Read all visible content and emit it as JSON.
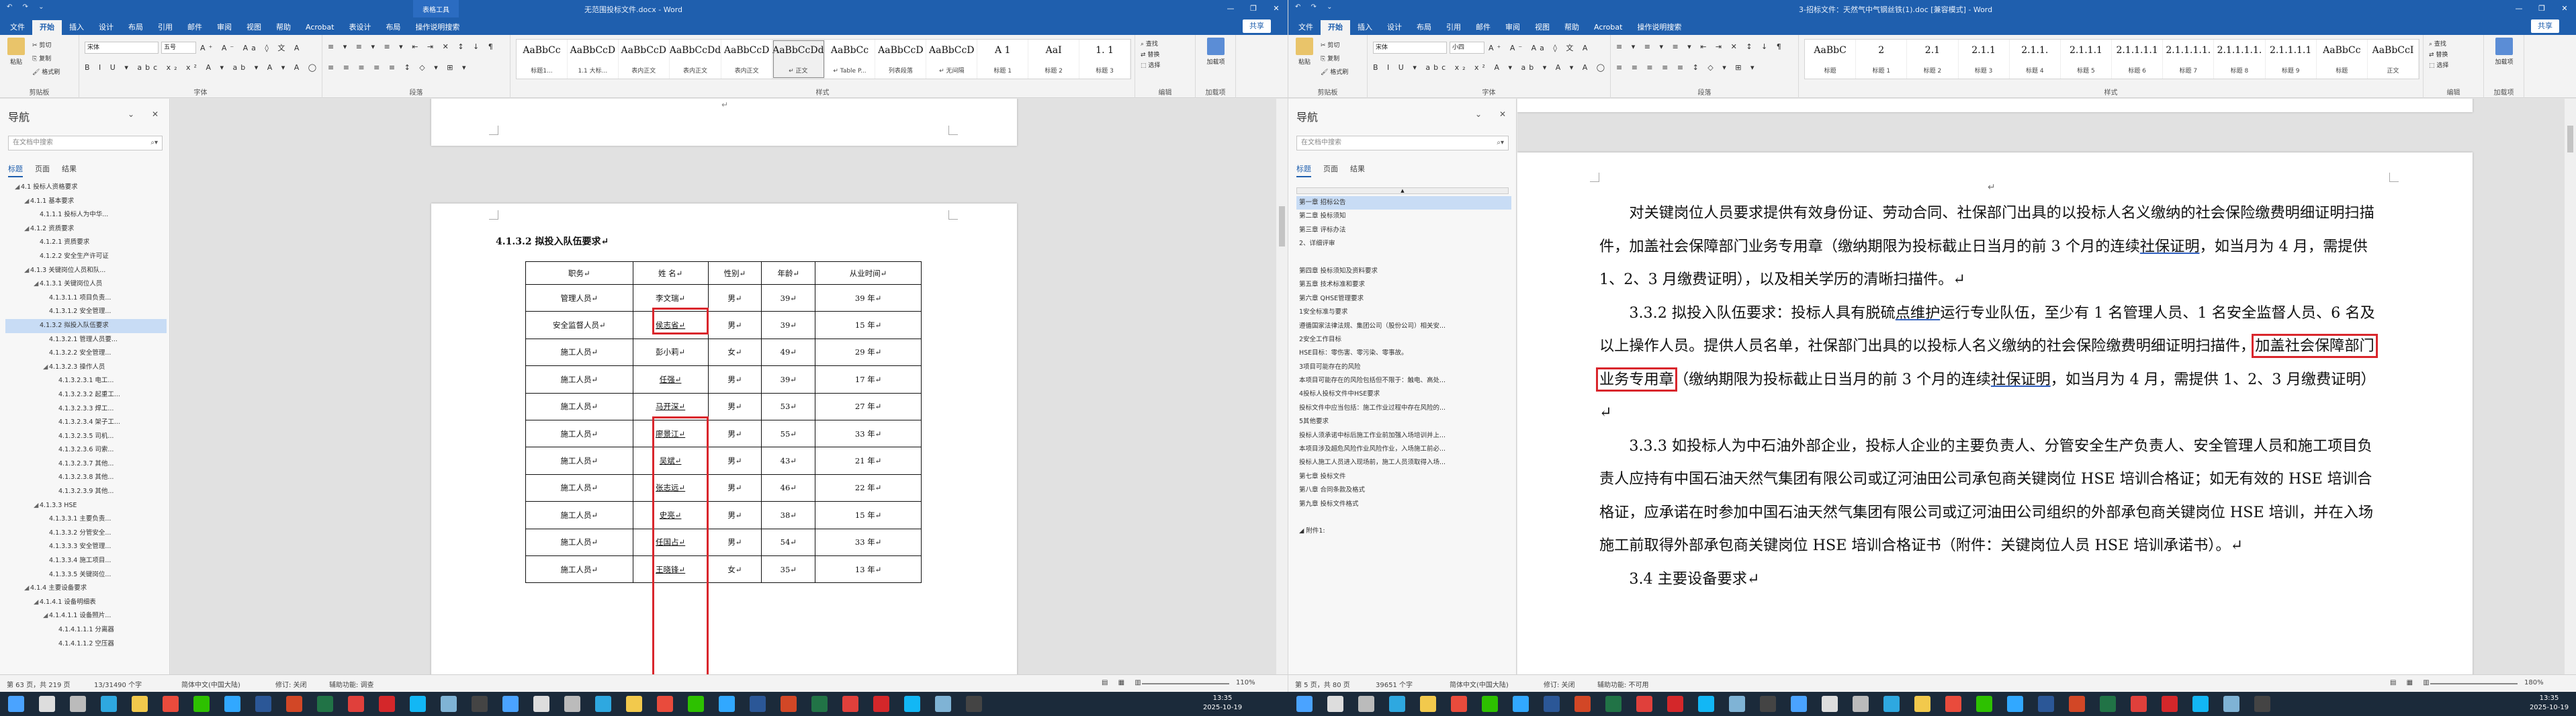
{
  "left": {
    "title": {
      "context_tab": "表格工具",
      "doc": "无范围投标文件.docx - Word",
      "quick_access": "↶ ↷ ⌄"
    },
    "tabs": [
      "文件",
      "开始",
      "插入",
      "设计",
      "布局",
      "引用",
      "邮件",
      "审阅",
      "视图",
      "帮助",
      "Acrobat",
      "表设计",
      "布局",
      "操作说明搜索"
    ],
    "share": "共享",
    "clipboard": {
      "paste": "粘贴",
      "cut": "剪切",
      "copy": "复制",
      "fmt": "格式刷",
      "label": "剪贴板"
    },
    "font": {
      "name": "宋体",
      "size": "五号",
      "label": "字体",
      "row1": "A⁺ A⁻ Aa ◊ 文 A",
      "row2": "B I U ▾ abc x₂ x²  A ▾ ab ▾ A ▾ A ◯"
    },
    "paragraph": {
      "label": "段落",
      "row1": "≡ ▾ ≡ ▾ ≡ ▾ ⇤ ⇥ ✕ ↕ ↓ ¶",
      "row2": "≡ ≡ ≡ ≡ ≡ ↕ ◇ ▾ ⊞ ▾"
    },
    "styles": {
      "label": "样式",
      "items": [
        {
          "preview": "AaBbCc",
          "name": "标题1..."
        },
        {
          "preview": "AaBbCcD",
          "name": "1.1 大标..."
        },
        {
          "preview": "AaBbCcD",
          "name": "表内正文"
        },
        {
          "preview": "AaBbCcDd",
          "name": "表内正文"
        },
        {
          "preview": "AaBbCcD",
          "name": "表内正文"
        },
        {
          "preview": "AaBbCcDd",
          "name": "↵ 正文"
        },
        {
          "preview": "AaBbCc",
          "name": "↵ Table P..."
        },
        {
          "preview": "AaBbCcD",
          "name": "列表段落"
        },
        {
          "preview": "AaBbCcD",
          "name": "↵ 无间隔"
        },
        {
          "preview": "A 1",
          "name": "标题 1"
        },
        {
          "preview": "AaI",
          "name": "标题 2"
        },
        {
          "preview": "1. 1",
          "name": "标题 3"
        }
      ]
    },
    "editing": {
      "find": "查找",
      "replace": "替换",
      "select": "选择",
      "label": "编辑"
    },
    "addin": {
      "name": "加载项",
      "label": "加载项"
    },
    "nav": {
      "title": "导航",
      "search_placeholder": "在文档中搜索",
      "tabs": [
        "标题",
        "页面",
        "结果"
      ],
      "items": [
        {
          "t": "◢",
          "label": "4.1 投标人资格要求",
          "lvl": 1,
          "hl": false
        },
        {
          "t": "◢",
          "label": "4.1.1 基本要求",
          "lvl": 2,
          "hl": false
        },
        {
          "t": "",
          "label": "4.1.1.1 投标人为中华...",
          "lvl": 3,
          "hl": false
        },
        {
          "t": "◢",
          "label": "4.1.2 资质要求",
          "lvl": 2,
          "hl": false
        },
        {
          "t": "",
          "label": "4.1.2.1 资质要求",
          "lvl": 3,
          "hl": false
        },
        {
          "t": "",
          "label": "4.1.2.2 安全生产许可证",
          "lvl": 3,
          "hl": false
        },
        {
          "t": "◢",
          "label": "4.1.3 关键岗位人员和队...",
          "lvl": 2,
          "hl": false
        },
        {
          "t": "◢",
          "label": "4.1.3.1 关键岗位人员",
          "lvl": 3,
          "hl": false
        },
        {
          "t": "",
          "label": "4.1.3.1.1 项目负责...",
          "lvl": 4,
          "hl": false
        },
        {
          "t": "",
          "label": "4.1.3.1.2 安全管理...",
          "lvl": 4,
          "hl": false
        },
        {
          "t": "",
          "label": "4.1.3.2 拟投入队伍要求",
          "lvl": 3,
          "hl": true
        },
        {
          "t": "",
          "label": "4.1.3.2.1 管理人员要...",
          "lvl": 4,
          "hl": false
        },
        {
          "t": "",
          "label": "4.1.3.2.2 安全管理...",
          "lvl": 4,
          "hl": false
        },
        {
          "t": "◢",
          "label": "4.1.3.2.3 操作人员",
          "lvl": 4,
          "hl": false
        },
        {
          "t": "",
          "label": "4.1.3.2.3.1 电工...",
          "lvl": 5,
          "hl": false
        },
        {
          "t": "",
          "label": "4.1.3.2.3.2 起重工...",
          "lvl": 5,
          "hl": false
        },
        {
          "t": "",
          "label": "4.1.3.2.3.3 焊工...",
          "lvl": 5,
          "hl": false
        },
        {
          "t": "",
          "label": "4.1.3.2.3.4 架子工...",
          "lvl": 5,
          "hl": false
        },
        {
          "t": "",
          "label": "4.1.3.2.3.5 司机...",
          "lvl": 5,
          "hl": false
        },
        {
          "t": "",
          "label": "4.1.3.2.3.6 司索...",
          "lvl": 5,
          "hl": false
        },
        {
          "t": "",
          "label": "4.1.3.2.3.7 其他...",
          "lvl": 5,
          "hl": false
        },
        {
          "t": "",
          "label": "4.1.3.2.3.8 其他...",
          "lvl": 5,
          "hl": false
        },
        {
          "t": "",
          "label": "4.1.3.2.3.9 其他...",
          "lvl": 5,
          "hl": false
        },
        {
          "t": "◢",
          "label": "4.1.3.3 HSE",
          "lvl": 3,
          "hl": false
        },
        {
          "t": "",
          "label": "4.1.3.3.1 主要负责...",
          "lvl": 4,
          "hl": false
        },
        {
          "t": "",
          "label": "4.1.3.3.2 分管安全...",
          "lvl": 4,
          "hl": false
        },
        {
          "t": "",
          "label": "4.1.3.3.3 安全管理...",
          "lvl": 4,
          "hl": false
        },
        {
          "t": "",
          "label": "4.1.3.3.4 施工项目...",
          "lvl": 4,
          "hl": false
        },
        {
          "t": "",
          "label": "4.1.3.3.5 关键岗位...",
          "lvl": 4,
          "hl": false
        },
        {
          "t": "◢",
          "label": "4.1.4 主要设备要求",
          "lvl": 2,
          "hl": false
        },
        {
          "t": "◢",
          "label": "4.1.4.1 设备明细表",
          "lvl": 3,
          "hl": false
        },
        {
          "t": "◢",
          "label": "4.1.4.1.1 设备照片...",
          "lvl": 4,
          "hl": false
        },
        {
          "t": "",
          "label": "4.1.4.1.1.1 分离器",
          "lvl": 5,
          "hl": false
        },
        {
          "t": "",
          "label": "4.1.4.1.1.2 空压器",
          "lvl": 5,
          "hl": false
        }
      ]
    },
    "heading": "4.1.3.2     拟投入队伍要求↵",
    "table": {
      "headers": [
        "职务↵",
        "姓  名↵",
        "性别↵",
        "年龄↵",
        "从业时间↵"
      ],
      "rows": [
        [
          "管理人员↵",
          "李文瑞↵",
          "男↵",
          "39↵",
          "39 年↵"
        ],
        [
          "安全监督人员↵",
          "侯志省↵",
          "男↵",
          "39↵",
          "15 年↵"
        ],
        [
          "施工人员↵",
          "彭小莉↵",
          "女↵",
          "49↵",
          "29 年↵"
        ],
        [
          "施工人员↵",
          "任强↵",
          "男↵",
          "39↵",
          "17 年↵"
        ],
        [
          "施工人员↵",
          "马开深↵",
          "男↵",
          "53↵",
          "27 年↵"
        ],
        [
          "施工人员↵",
          "廖景江↵",
          "男↵",
          "55↵",
          "33 年↵"
        ],
        [
          "施工人员↵",
          "吴斌↵",
          "男↵",
          "43↵",
          "21 年↵"
        ],
        [
          "施工人员↵",
          "张志远↵",
          "男↵",
          "46↵",
          "22 年↵"
        ],
        [
          "施工人员↵",
          "史亮↵",
          "男↵",
          "38↵",
          "15 年↵"
        ],
        [
          "施工人员↵",
          "任国占↵",
          "男↵",
          "54↵",
          "33 年↵"
        ],
        [
          "施工人员↵",
          "王晓锋↵",
          "女↵",
          "35↵",
          "13 年↵"
        ]
      ]
    },
    "status": {
      "page": "第 63 页，共 219 页",
      "words": "13/31490 个字",
      "lang": "简体中文(中国大陆)",
      "track": "修订: 关闭",
      "access": "辅助功能: 调查",
      "zoom": "110%"
    }
  },
  "right": {
    "title": {
      "doc": "3-招标文件：天然气中气钢丝铁(1).doc [兼容模式] - Word",
      "quick_access": "↶ ↷ ⌄"
    },
    "tabs": [
      "文件",
      "开始",
      "插入",
      "设计",
      "布局",
      "引用",
      "邮件",
      "审阅",
      "视图",
      "帮助",
      "Acrobat",
      "操作说明搜索"
    ],
    "share": "共享",
    "clipboard": {
      "paste": "粘贴",
      "cut": "剪切",
      "copy": "复制",
      "fmt": "格式刷",
      "label": "剪贴板"
    },
    "font": {
      "name": "宋体",
      "size": "小四",
      "label": "字体",
      "row1": "A⁺ A⁻ Aa ◊ 文 A",
      "row2": "B I U ▾ abc x₂ x²  A ▾ ab ▾ A ▾ A ◯"
    },
    "paragraph": {
      "label": "段落",
      "row1": "≡ ▾ ≡ ▾ ≡ ▾ ⇤ ⇥ ✕ ↕ ↓ ¶",
      "row2": "≡ ≡ ≡ ≡ ≡ ↕ ◇ ▾ ⊞ ▾"
    },
    "styles": {
      "label": "样式",
      "items": [
        {
          "preview": "AaBbC",
          "name": "标题"
        },
        {
          "preview": "2",
          "name": "标题 1"
        },
        {
          "preview": "2.1",
          "name": "标题 2"
        },
        {
          "preview": "2.1.1",
          "name": "标题 3"
        },
        {
          "preview": "2.1.1.",
          "name": "标题 4"
        },
        {
          "preview": "2.1.1.1",
          "name": "标题 5"
        },
        {
          "preview": "2.1.1.1.1",
          "name": "标题 6"
        },
        {
          "preview": "2.1.1.1.1.",
          "name": "标题 7"
        },
        {
          "preview": "2.1.1.1.1.",
          "name": "标题 8"
        },
        {
          "preview": "2.1.1.1.1",
          "name": "标题 9"
        },
        {
          "preview": "AaBbCc",
          "name": "标题"
        },
        {
          "preview": "AaBbCcI",
          "name": "正文"
        }
      ]
    },
    "editing": {
      "find": "查找",
      "replace": "替换",
      "select": "选择",
      "label": "编辑"
    },
    "addin": {
      "name": "加载项",
      "label": "加载项"
    },
    "nav": {
      "title": "导航",
      "search_placeholder": "在文档中搜索",
      "tabs": [
        "标题",
        "页面",
        "结果"
      ],
      "items": [
        {
          "label": "第一章  招标公告",
          "hl": true
        },
        {
          "label": "第二章  投标须知",
          "hl": false
        },
        {
          "label": "第三章  评标办法",
          "hl": false
        },
        {
          "label": "    2、详细评审",
          "hl": false
        },
        {
          "label": "",
          "hl": false
        },
        {
          "label": "第四章  投标须知及资料要求",
          "hl": false
        },
        {
          "label": "第五章  技术标准和要求",
          "hl": false
        },
        {
          "label": "第六章  QHSE管理要求",
          "hl": false
        },
        {
          "label": "1安全标准与要求",
          "hl": false
        },
        {
          "label": "遵循国家法律法规、集团公司（股份公司）相关安...",
          "hl": false
        },
        {
          "label": "2安全工作目标",
          "hl": false
        },
        {
          "label": "HSE目标：零伤害、零污染、零事故。",
          "hl": false
        },
        {
          "label": "3项目可能存在的风险",
          "hl": false
        },
        {
          "label": "本项目可能存在的风险包括但不限于：触电、高处...",
          "hl": false
        },
        {
          "label": "4投标人投标文件中HSE要求",
          "hl": false
        },
        {
          "label": "投标文件中应当包括：施工作业过程中存在风险的...",
          "hl": false
        },
        {
          "label": "5其他要求",
          "hl": false
        },
        {
          "label": "投标人须承诺中标后施工作业前加强入场培训并上...",
          "hl": false
        },
        {
          "label": "本项目涉及超危风险作业风险作业，入场施工前必...",
          "hl": false
        },
        {
          "label": "投标人施工人员进入现场前，施工人员须取得入场...",
          "hl": false
        },
        {
          "label": "第七章  投标文件",
          "hl": false
        },
        {
          "label": "第八章  合同条款及格式",
          "hl": false
        },
        {
          "label": "第九章  投标文件格式",
          "hl": false
        },
        {
          "label": "",
          "hl": false
        },
        {
          "label": "◢  附件1:",
          "hl": false
        }
      ]
    },
    "paragraphs": [
      {
        "segments": [
          {
            "t": "对关键岗位人员要求提供有效身份证、劳动合同、社保部门出具的以投标人名义缴纳的社会保险缴费明细证明扫描件，加盖社会保障部门业务专用章（缴纳期限为投标截止日当月的前 3 个月的连续",
            "u": false
          },
          {
            "t": "社保证明",
            "u": true
          },
          {
            "t": "，如当月为 4 月，需提供 1、2、3 月缴费证明），以及相关学历的清晰扫描件。↵",
            "u": false
          }
        ]
      },
      {
        "segments": [
          {
            "t": "3.3.2 拟投入队伍要求：投标人具有脱硫",
            "u": false
          },
          {
            "t": "点维护",
            "u": true
          },
          {
            "t": "运行专业队伍，至少有 1 名管理人员、1 名安全监督人员、6 名及以上操作人员。提供人员名单，社保部门出具的以投标人名义缴纳的社会保险缴费明细证明扫描件，",
            "u": false
          },
          {
            "t": "加盖社会保障部门业务专用章",
            "u": false,
            "box": true
          },
          {
            "t": "（缴纳期限为投标截止日当月的前 3 个月的连续",
            "u": false
          },
          {
            "t": "社保证明",
            "u": true
          },
          {
            "t": "，如当月为 4 月，需提供 1、2、3 月缴费证明）↵",
            "u": false
          }
        ]
      },
      {
        "segments": [
          {
            "t": "3.3.3 如投标人为中石油外部企业，投标人企业的主要负责人、分管安全生产负责人、安全管理人员和施工项目负责人应持有中国石油天然气集团有限公司或辽河油田公司承包商关键岗位 HSE 培训合格证；如无有效的 HSE 培训合格证，应承诺在时参加中国石油天然气集团有限公司或辽河油田公司组织的外部承包商关键岗位 HSE 培训，并在入场施工前取得外部承包商关键岗位 HSE 培训合格证书（附件：关键岗位人员 HSE 培训承诺书）。↵",
            "u": false
          }
        ]
      },
      {
        "segments": [
          {
            "t": "3.4 主要设备要求↵",
            "u": false
          }
        ]
      }
    ],
    "top_mark": "↵",
    "status": {
      "page": "第 5 页，共 80 页",
      "words": "39651 个字",
      "lang": "简体中文(中国大陆)",
      "track": "修订: 关闭",
      "access": "辅助功能: 不可用",
      "zoom": "180%"
    }
  },
  "taskbar": {
    "clock_left": {
      "time": "13:35",
      "date": "2025-10-19"
    },
    "clock_right": {
      "time": "13:35",
      "date": "2025-10-19"
    },
    "icons": [
      "windows-start",
      "search",
      "task-view",
      "edge",
      "file-explorer",
      "chrome",
      "wechat",
      "photoshop",
      "word",
      "powerpoint",
      "excel",
      "wps",
      "acrobat",
      "qq",
      "notepad",
      "terminal"
    ]
  }
}
